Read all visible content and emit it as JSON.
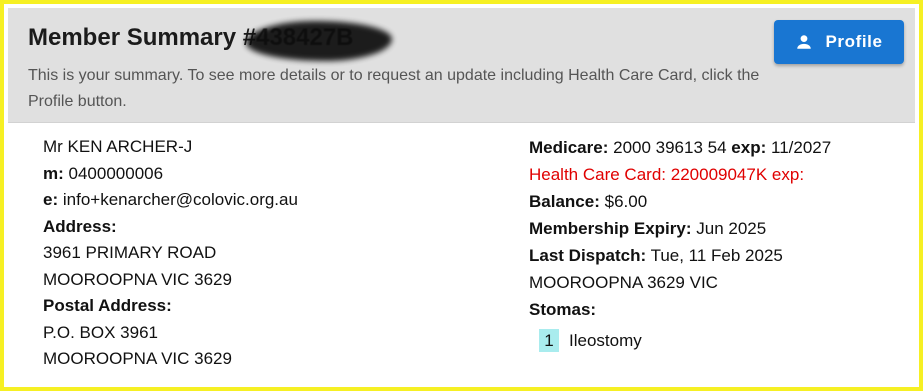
{
  "header": {
    "title": "Member Summary #",
    "member_id": "438427B",
    "subtitle": "This is your summary. To see more details or to request an update including Health Care Card, click the Profile button.",
    "profile_button": {
      "label": "Profile",
      "icon": "person-icon"
    }
  },
  "contact": {
    "name": "Mr KEN ARCHER-J",
    "mobile_label": "m:",
    "mobile": "0400000006",
    "email_label": "e:",
    "email": "info+kenarcher@colovic.org.au",
    "address_label": "Address:",
    "address_line1": "3961 PRIMARY ROAD",
    "address_line2": "MOOROOPNA VIC 3629",
    "postal_label": "Postal Address:",
    "postal_line1": "P.O. BOX 3961",
    "postal_line2": "MOOROOPNA VIC 3629"
  },
  "details": {
    "medicare_label": "Medicare:",
    "medicare": "2000 39613 54",
    "medicare_exp_label": "exp:",
    "medicare_exp": "11/2027",
    "health_care_label": "Health Care Card:",
    "health_care": "220009047K",
    "health_care_exp_label": "exp:",
    "balance_label": "Balance:",
    "balance": "$6.00",
    "membership_expiry_label": "Membership Expiry:",
    "membership_expiry": "Jun 2025",
    "last_dispatch_label": "Last Dispatch:",
    "last_dispatch": "Tue, 11 Feb 2025",
    "dispatch_location": "MOOROOPNA 3629 VIC",
    "stomas_label": "Stomas:",
    "stomas": [
      {
        "number": "1",
        "name": "Ileostomy"
      }
    ]
  },
  "colors": {
    "border": "#f6f023",
    "header_bg": "#e0e0e0",
    "button": "#1976d2",
    "alert_text": "#e00000",
    "stoma_badge": "#a9ecee"
  }
}
